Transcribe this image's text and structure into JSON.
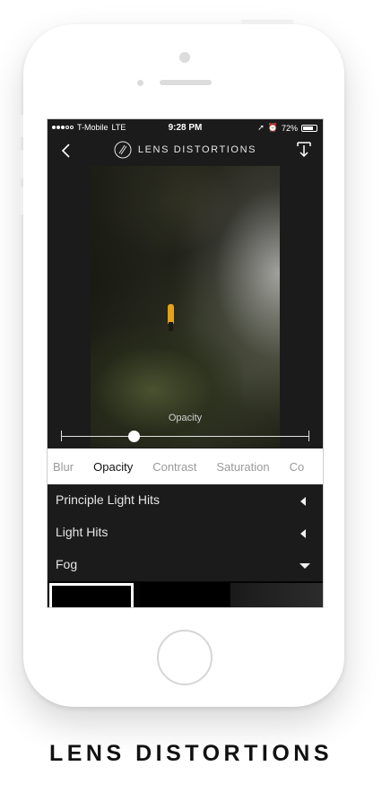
{
  "status_bar": {
    "carrier": "T-Mobile",
    "network": "LTE",
    "time": "9:28 PM",
    "battery": "72%"
  },
  "nav": {
    "title": "LENS DISTORTIONS",
    "back_icon": "chevron-left-icon",
    "download_icon": "download-icon"
  },
  "slider": {
    "label": "Opacity",
    "value": 0.29
  },
  "tabs": [
    {
      "label": "Blur",
      "active": false
    },
    {
      "label": "Opacity",
      "active": true
    },
    {
      "label": "Contrast",
      "active": false
    },
    {
      "label": "Saturation",
      "active": false
    },
    {
      "label": "Co",
      "active": false
    }
  ],
  "layers": [
    {
      "label": "Principle Light Hits",
      "icon": "triangle-left-icon"
    },
    {
      "label": "Light Hits",
      "icon": "triangle-left-icon"
    },
    {
      "label": "Fog",
      "icon": "triangle-down-icon"
    }
  ],
  "caption": "LENS DISTORTIONS"
}
